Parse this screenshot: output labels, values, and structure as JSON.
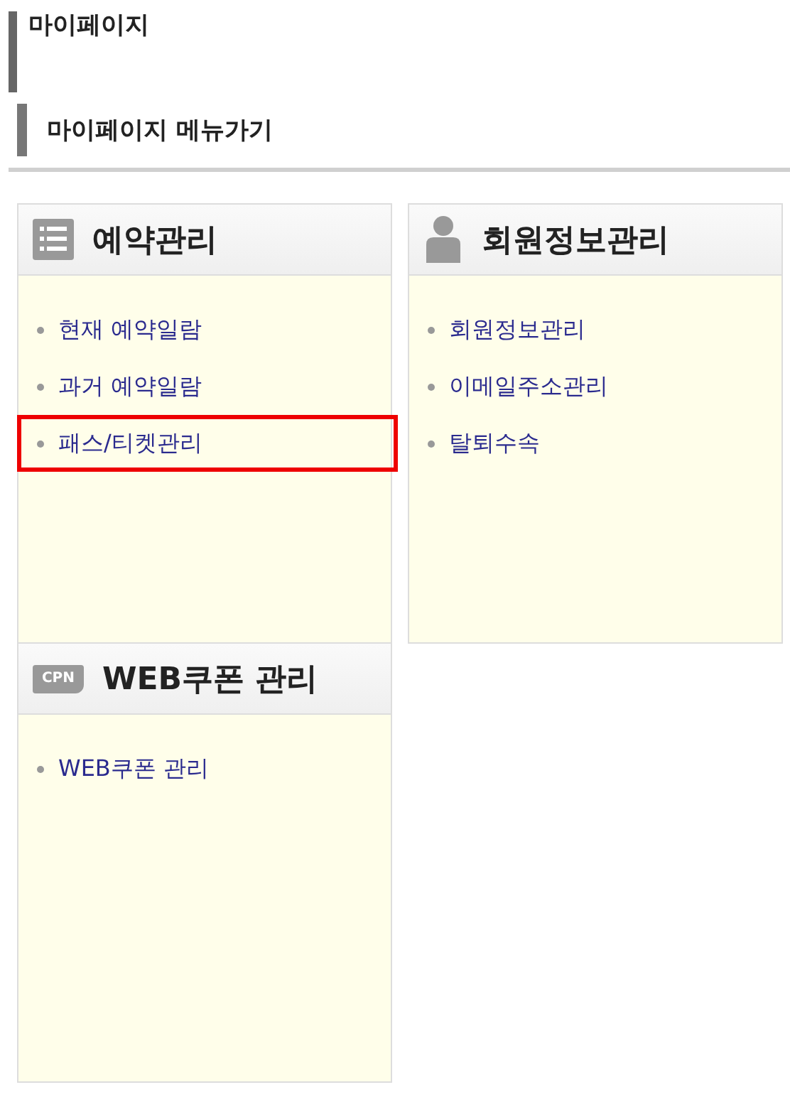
{
  "page_title": "마이페이지",
  "section_title": "마이페이지 메뉴가기",
  "cards": [
    {
      "title": "예약관리",
      "kind": "list",
      "items": [
        {
          "label": "현재 예약일람",
          "highlighted": false
        },
        {
          "label": "과거 예약일람",
          "highlighted": false
        },
        {
          "label": "패스/티켓관리",
          "highlighted": true
        }
      ]
    },
    {
      "title": "회원정보관리",
      "kind": "person",
      "items": [
        {
          "label": "회원정보관리",
          "highlighted": false
        },
        {
          "label": "이메일주소관리",
          "highlighted": false
        },
        {
          "label": "탈퇴수속",
          "highlighted": false
        }
      ]
    },
    {
      "title": "WEB쿠폰 관리",
      "kind": "coupon",
      "icon_text": "CPN",
      "items": [
        {
          "label": "WEB쿠폰 관리",
          "highlighted": false
        }
      ]
    }
  ]
}
